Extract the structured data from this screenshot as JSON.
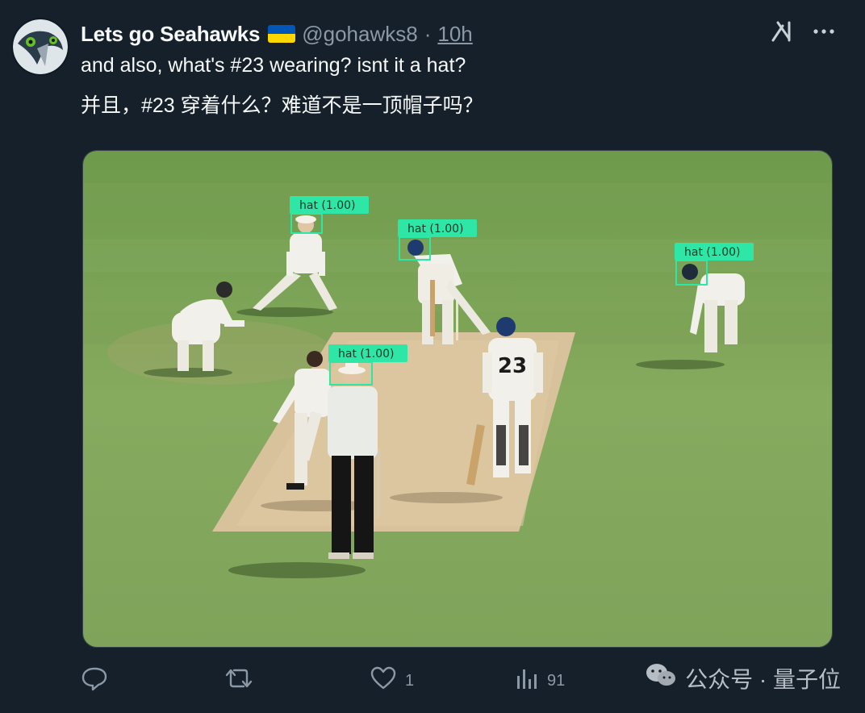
{
  "tweet": {
    "display_name": "Lets go Seahawks",
    "handle": "@gohawks8",
    "separator": "·",
    "time": "10h",
    "text_line_1": "and also, what's #23 wearing? isnt it a hat?",
    "text_line_2": "并且，#23 穿着什么？难道不是一顶帽子吗？"
  },
  "header_icons": {
    "flag": "ukraine-flag-icon",
    "grok": "grok-icon",
    "more": "more-icon"
  },
  "media": {
    "detections": [
      {
        "label": "hat (1.00)"
      },
      {
        "label": "hat (1.00)"
      },
      {
        "label": "hat (1.00)"
      },
      {
        "label": "hat (1.00)"
      }
    ],
    "player_number": "23"
  },
  "actions": {
    "reply_count": "",
    "retweet_count": "",
    "like_count": "1",
    "views_count": "91"
  },
  "watermark": {
    "text": "公众号 · 量子位"
  },
  "colors": {
    "background": "#15202b",
    "text_primary": "#f7f9f9",
    "text_secondary": "#8b98a5",
    "detection_box": "#2ee6a6",
    "field_green": "#7da45a",
    "pitch": "#d8c29c"
  }
}
